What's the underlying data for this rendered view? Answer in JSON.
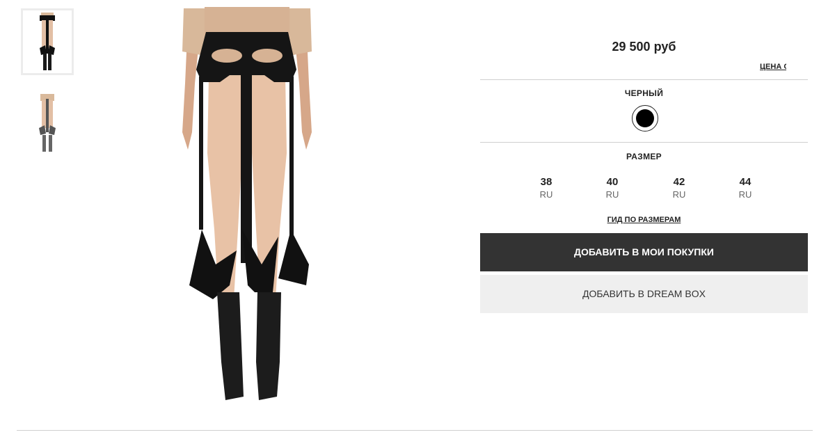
{
  "gallery": {
    "thumbnails": [
      {
        "name": "thumbnail-front",
        "active": true
      },
      {
        "name": "thumbnail-back",
        "active": false
      }
    ]
  },
  "product": {
    "price": "29 500 руб",
    "price_link": "ЦЕНА С"
  },
  "color": {
    "label": "ЧЕРНЫЙ",
    "swatch_color": "#000000"
  },
  "size": {
    "label": "РАЗМЕР",
    "options": [
      {
        "value": "38",
        "unit": "RU"
      },
      {
        "value": "40",
        "unit": "RU"
      },
      {
        "value": "42",
        "unit": "RU"
      },
      {
        "value": "44",
        "unit": "RU"
      }
    ],
    "guide_label": "ГИД ПО РАЗМЕРАМ"
  },
  "actions": {
    "add_to_cart": "ДОБАВИТЬ В МОИ ПОКУПКИ",
    "add_to_dreambox": "ДОБАВИТЬ В DREAM BOX"
  },
  "colors": {
    "primary_button_bg": "#333333",
    "secondary_button_bg": "#efefef",
    "divider": "#cfcfcf"
  }
}
